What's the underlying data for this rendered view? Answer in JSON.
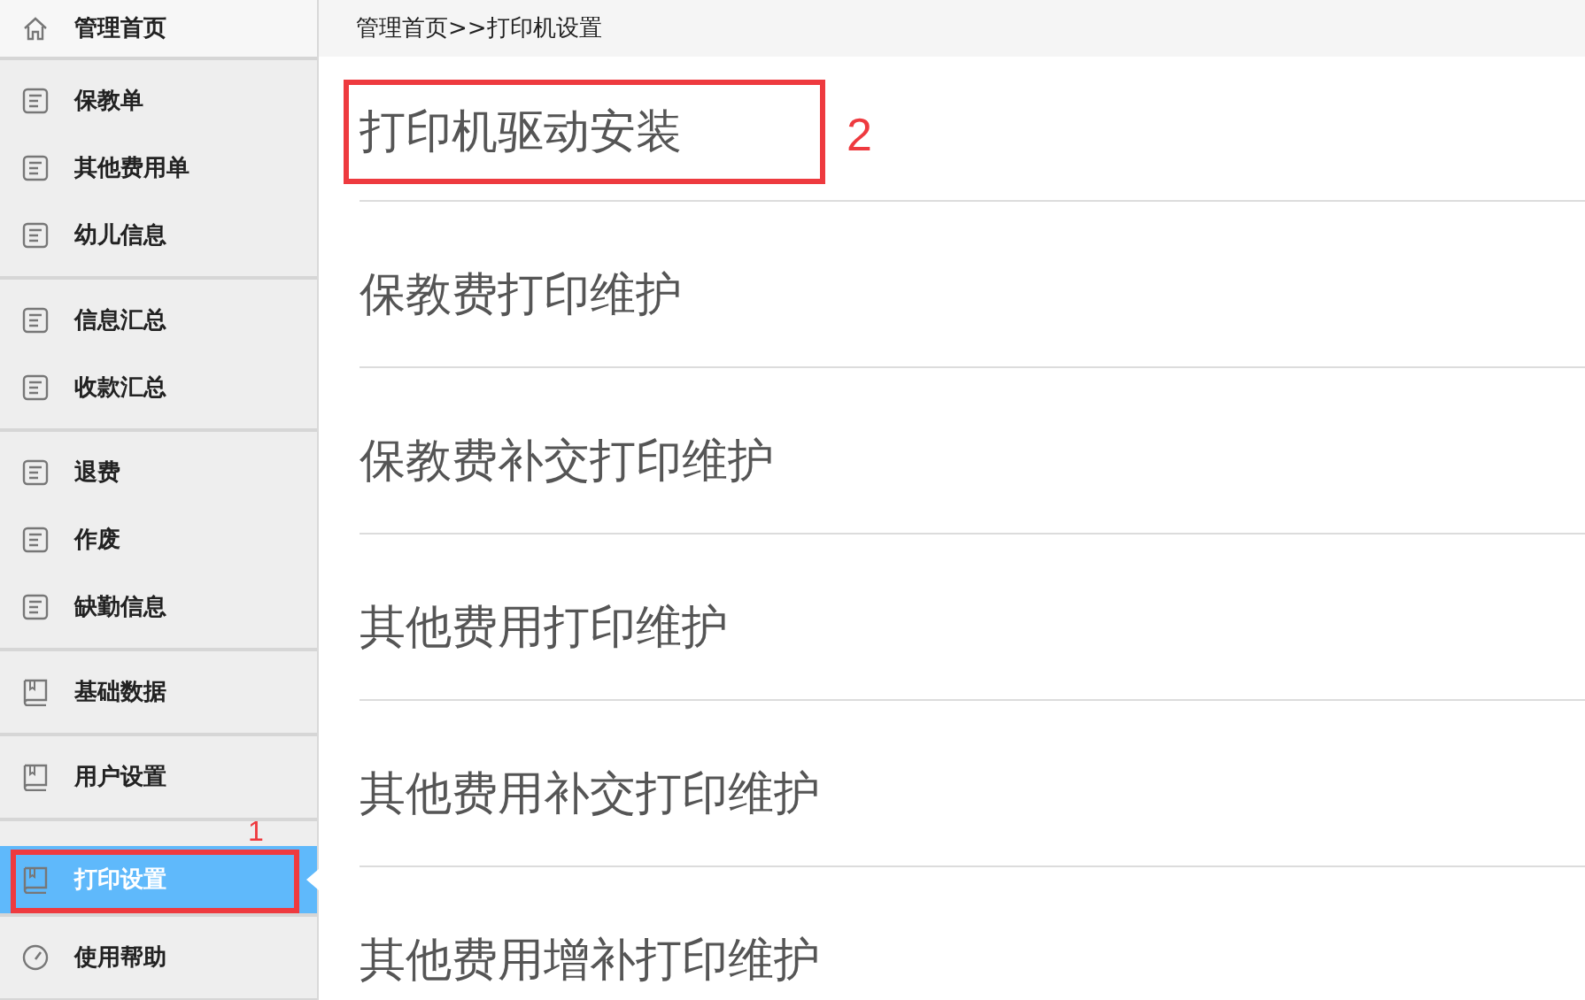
{
  "sidebar": {
    "groups": [
      {
        "items": [
          {
            "label": "管理首页",
            "kind": "home",
            "selected": false
          }
        ]
      },
      {
        "items": [
          {
            "label": "保教单",
            "kind": "doc",
            "selected": false
          },
          {
            "label": "其他费用单",
            "kind": "doc",
            "selected": false
          },
          {
            "label": "幼儿信息",
            "kind": "doc",
            "selected": false
          }
        ]
      },
      {
        "items": [
          {
            "label": "信息汇总",
            "kind": "doc",
            "selected": false
          },
          {
            "label": "收款汇总",
            "kind": "doc",
            "selected": false
          }
        ]
      },
      {
        "items": [
          {
            "label": "退费",
            "kind": "doc",
            "selected": false
          },
          {
            "label": "作废",
            "kind": "doc",
            "selected": false
          },
          {
            "label": "缺勤信息",
            "kind": "doc",
            "selected": false
          }
        ]
      },
      {
        "items": [
          {
            "label": "基础数据",
            "kind": "book",
            "selected": false
          }
        ]
      },
      {
        "items": [
          {
            "label": "用户设置",
            "kind": "book",
            "selected": false
          }
        ]
      },
      {
        "items": [
          {
            "label": "打印设置",
            "kind": "book",
            "selected": true,
            "annotation": "1"
          }
        ]
      },
      {
        "items": [
          {
            "label": "使用帮助",
            "kind": "gauge",
            "selected": false
          }
        ]
      }
    ]
  },
  "breadcrumb": "管理首页>>打印机设置",
  "links": [
    {
      "label": "打印机驱动安装",
      "annotation": "2"
    },
    {
      "label": "保教费打印维护"
    },
    {
      "label": "保教费补交打印维护"
    },
    {
      "label": "其他费用打印维护"
    },
    {
      "label": "其他费用补交打印维护"
    },
    {
      "label": "其他费用增补打印维护"
    }
  ]
}
